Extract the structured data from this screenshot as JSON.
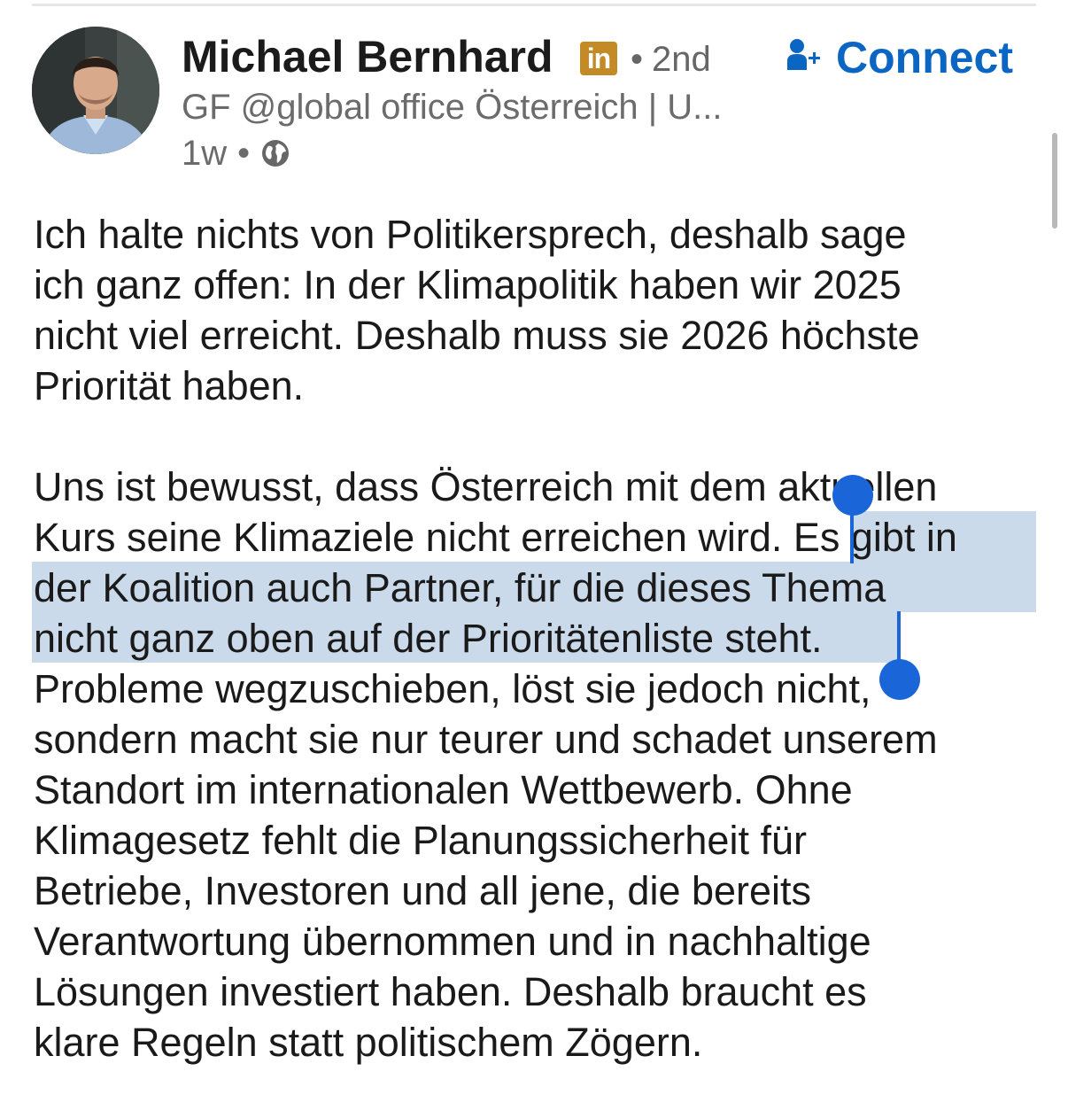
{
  "author": {
    "name": "Michael Bernhard",
    "badge_text": "in",
    "degree_separator": "•",
    "degree": "2nd",
    "headline": "GF @global office Österreich | U...",
    "time": "1w",
    "meta_separator": "•",
    "visibility_icon": "globe-icon",
    "avatar_icon": "profile-photo"
  },
  "connect": {
    "label": "Connect",
    "icon": "add-person-icon"
  },
  "post": {
    "paragraph_1": "Ich halte nichts von Politikersprech, deshalb sage\nich ganz offen: In der Klimapolitik haben wir 2025\nnicht viel erreicht. Deshalb muss sie 2026 höchste\nPriorität haben.",
    "paragraph_2": "Uns ist bewusst, dass Österreich mit dem aktuellen\nKurs seine Klimaziele nicht erreichen wird. Es gibt in\nder Koalition auch Partner, für die dieses Thema\nnicht ganz oben auf der Prioritätenliste steht.\nProbleme wegzuschieben, löst sie jedoch nicht,\nsondern macht sie nur teurer und schadet unserem\nStandort im internationalen Wettbewerb. Ohne\nKlimagesetz fehlt die Planungssicherheit für\nBetriebe, Investoren und all jene, die bereits\nVerantwortung übernommen und in nachhaltige\nLösungen investiert haben. Deshalb braucht es\nklare Regeln statt politischem Zögern.",
    "selected_text": "Es gibt in der Koalition auch Partner, für die dieses Thema nicht ganz oben auf der Prioritätenliste steht."
  },
  "colors": {
    "accent": "#0a66c2",
    "selection_handle": "#1a66d8",
    "selection_highlight": "#cfdcea",
    "badge": "#c48a25",
    "secondary_text": "#6b6b6b"
  }
}
